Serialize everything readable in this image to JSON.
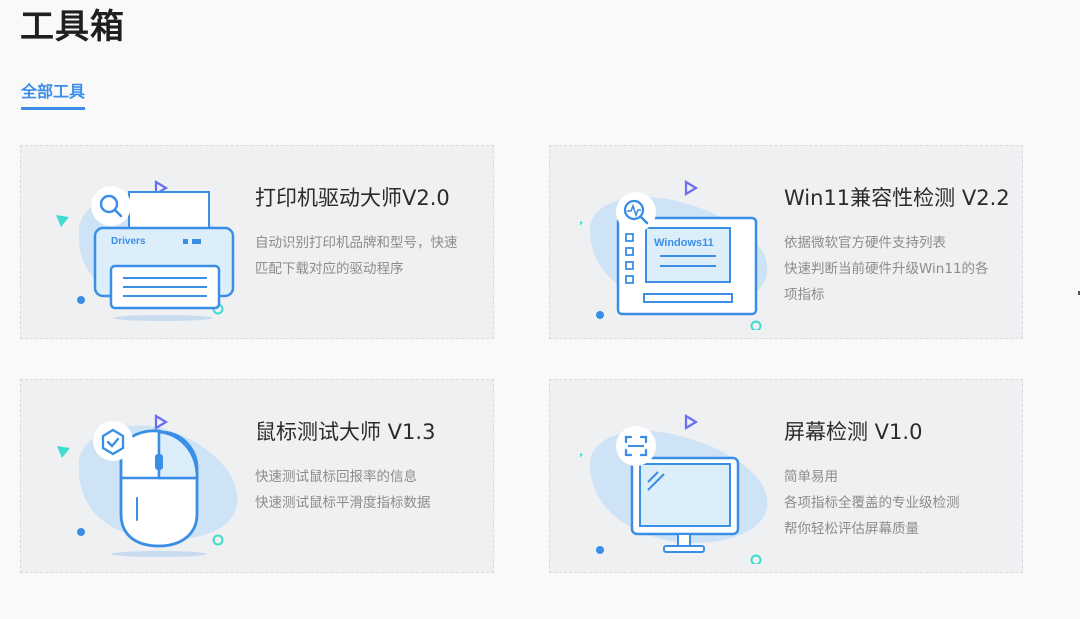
{
  "page": {
    "title": "工具箱"
  },
  "tabs": [
    {
      "label": "全部工具",
      "active": true
    }
  ],
  "colors": {
    "accent": "#3a8ee6",
    "card_bg": "#eff0f2",
    "illus_blue": "#3a8ee6",
    "illus_fill": "#cfe3f6",
    "cyan": "#3fdad0",
    "purple": "#6a6ef0"
  },
  "tools": [
    {
      "name": "打印机驱动大师V2.0",
      "icon": "search-icon",
      "illustration": "printer",
      "illus_label": "Drivers",
      "desc": [
        "自动识别打印机品牌和型号，快速",
        "匹配下载对应的驱动程序"
      ]
    },
    {
      "name": "Win11兼容性检测 V2.2",
      "icon": "heartbeat-search-icon",
      "illustration": "windows-window",
      "illus_label": "Windows11",
      "desc": [
        "依据微软官方硬件支持列表",
        "快速判断当前硬件升级Win11的各",
        "项指标"
      ]
    },
    {
      "name": "鼠标测试大师 V1.3",
      "icon": "shield-check-icon",
      "illustration": "mouse",
      "illus_label": "",
      "desc": [
        "快速测试鼠标回报率的信息",
        "快速测试鼠标平滑度指标数据"
      ]
    },
    {
      "name": "屏幕检测 V1.0",
      "icon": "scan-frame-icon",
      "illustration": "monitor",
      "illus_label": "",
      "desc": [
        "简单易用",
        "各项指标全覆盖的专业级检测",
        "帮你轻松评估屏幕质量"
      ]
    }
  ]
}
